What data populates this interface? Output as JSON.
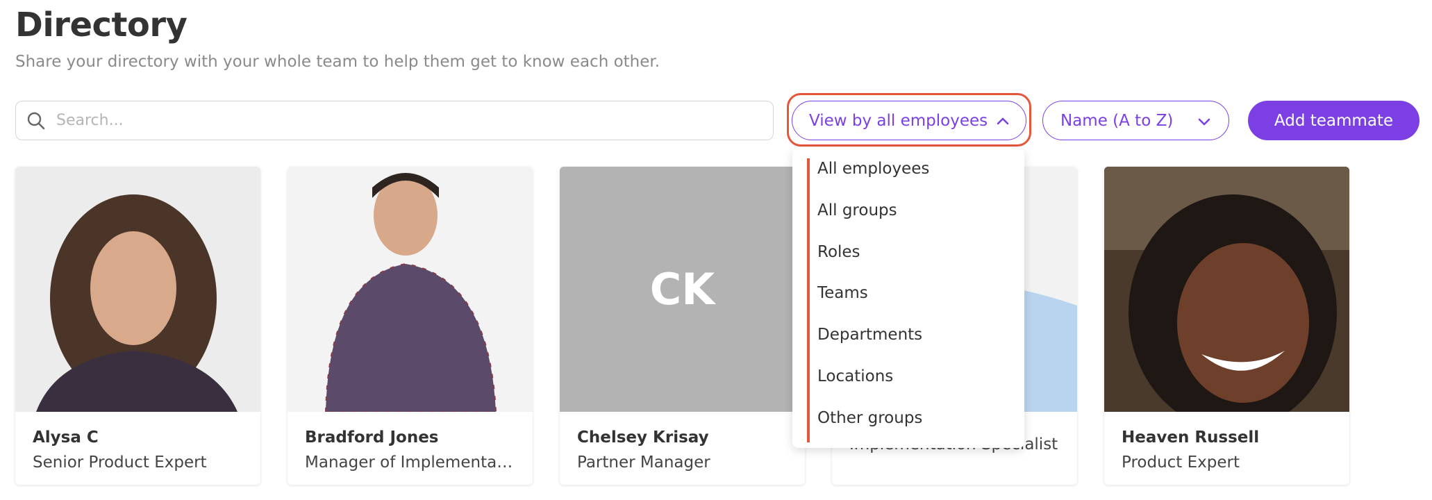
{
  "header": {
    "title": "Directory",
    "subtitle": "Share your directory with your whole team to help them get to know each other."
  },
  "search": {
    "placeholder": "Search...",
    "value": ""
  },
  "toolbar": {
    "view_label": "View by all employees",
    "sort_label": "Name (A to Z)",
    "add_label": "Add teammate"
  },
  "view_menu": {
    "options": [
      "All employees",
      "All groups",
      "Roles",
      "Teams",
      "Departments",
      "Locations",
      "Other groups"
    ]
  },
  "people": [
    {
      "name": "Alysa C",
      "role": "Senior Product Expert",
      "avatar": "photo"
    },
    {
      "name": "Bradford Jones",
      "role": "Manager of Implementation",
      "avatar": "photo"
    },
    {
      "name": "Chelsey Krisay",
      "role": "Partner Manager",
      "avatar": "initials",
      "initials": "CK"
    },
    {
      "name": "",
      "role": "Implementation Specialist",
      "avatar": "photo"
    },
    {
      "name": "Heaven Russell",
      "role": "Product Expert",
      "avatar": "photo"
    }
  ],
  "colors": {
    "accent": "#7b3fe4",
    "highlight": "#e5553a",
    "initials_bg": "#b3b3b3"
  },
  "icons": {
    "search": "search-icon",
    "view_chevron": "chevron-up-icon",
    "sort_chevron": "chevron-down-icon"
  }
}
